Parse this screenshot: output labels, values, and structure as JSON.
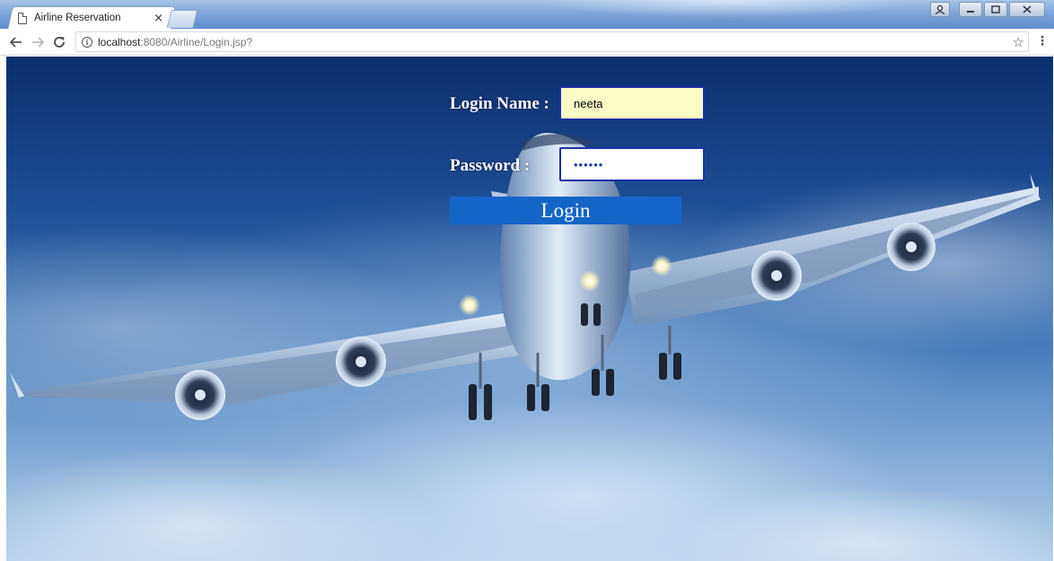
{
  "browser": {
    "tab_title": "Airline Reservation",
    "tab_close": "×",
    "url_host": "localhost",
    "url_path": ":8080/Airline/Login.jsp?"
  },
  "form": {
    "login_label": "Login Name :",
    "login_value": "neeta",
    "password_label": "Password :",
    "password_value": "••••••",
    "submit_label": "Login"
  },
  "icons": {
    "back": "back-arrow-icon",
    "forward": "forward-arrow-icon",
    "reload": "reload-icon",
    "info": "info-icon",
    "star": "star-icon",
    "menu": "menu-icon"
  },
  "colors": {
    "button": "#1565c9",
    "login_input_bg": "#fbfbc6",
    "input_border": "#1f2fa8"
  }
}
